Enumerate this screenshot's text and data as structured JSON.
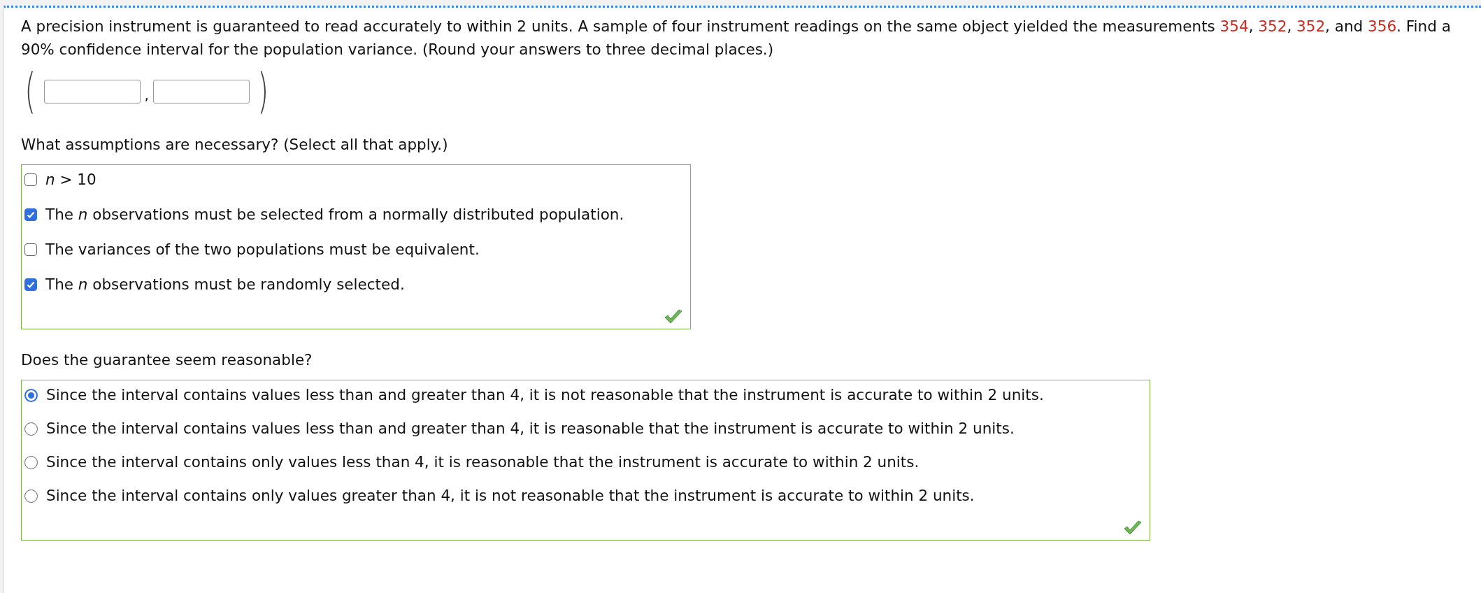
{
  "question": {
    "parts": [
      {
        "kind": "plain",
        "text": "A precision instrument is guaranteed to read accurately to within 2 units. A sample of four instrument readings on the same object yielded the measurements "
      },
      {
        "kind": "value",
        "text": "354"
      },
      {
        "kind": "plain",
        "text": ", "
      },
      {
        "kind": "value",
        "text": "352"
      },
      {
        "kind": "plain",
        "text": ", "
      },
      {
        "kind": "value",
        "text": "352"
      },
      {
        "kind": "plain",
        "text": ", and "
      },
      {
        "kind": "value",
        "text": "356"
      },
      {
        "kind": "plain",
        "text": ". Find a 90% confidence interval for the population variance. (Round your answers to three decimal places.)"
      }
    ]
  },
  "interval": {
    "open": "(",
    "separator": ",",
    "close": ")",
    "fields": [
      {
        "kind": "blank"
      },
      {
        "kind": "blank"
      }
    ]
  },
  "assumptions": {
    "prompt": "What assumptions are necessary? (Select all that apply.)",
    "correct": true,
    "options": [
      {
        "label": "*n* > 10",
        "checked": false
      },
      {
        "label": "The *n* observations must be selected from a normally distributed population.",
        "checked": true
      },
      {
        "label": "The variances of the two populations must be equivalent.",
        "checked": false
      },
      {
        "label": "The *n* observations must be randomly selected.",
        "checked": true
      }
    ]
  },
  "guarantee": {
    "prompt": "Does the guarantee seem reasonable?",
    "correct": true,
    "options": [
      {
        "label": "Since the interval contains values less than and greater than 4, it is not reasonable that the instrument is accurate to within 2 units.",
        "selected": true
      },
      {
        "label": "Since the interval contains values less than and greater than 4, it is reasonable that the instrument is accurate to within 2 units.",
        "selected": false
      },
      {
        "label": "Since the interval contains only values less than 4, it is reasonable that the instrument is accurate to within 2 units.",
        "selected": false
      },
      {
        "label": "Since the interval contains only values greater than 4, it is not reasonable that the instrument is accurate to within 2 units.",
        "selected": false
      }
    ]
  }
}
